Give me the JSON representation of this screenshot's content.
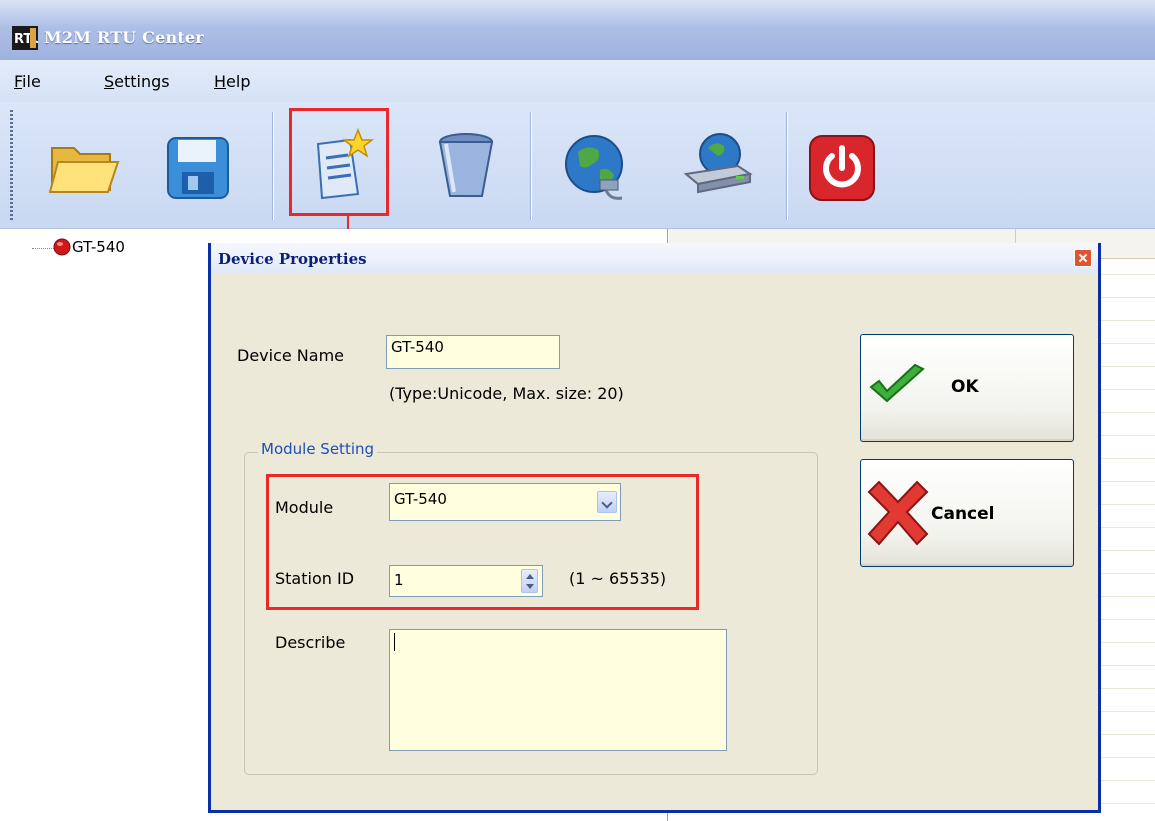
{
  "window": {
    "title": "M2M RTU Center"
  },
  "menu": [
    {
      "label": "File",
      "mnemonic": "F",
      "rest": "ile"
    },
    {
      "label": "Settings",
      "mnemonic": "S",
      "rest": "ettings"
    },
    {
      "label": "Help",
      "mnemonic": "H",
      "rest": "elp"
    }
  ],
  "toolbar": {
    "buttons": [
      "open-folder-icon",
      "save-disk-icon",
      "new-document-icon",
      "trash-bin-icon",
      "network-globe-icon",
      "network-device-icon",
      "power-icon"
    ],
    "highlighted": "new-document-icon"
  },
  "tree": {
    "nodes": [
      {
        "label": "GT-540",
        "status_color": "#d01818"
      }
    ]
  },
  "dialog": {
    "title": "Device Properties",
    "device_name_label": "Device Name",
    "device_name_value": "GT-540",
    "device_name_hint": "(Type:Unicode, Max. size: 20)",
    "group_title": "Module Setting",
    "module_label": "Module",
    "module_value": "GT-540",
    "station_label": "Station ID",
    "station_value": "1",
    "station_range": "(1 ~ 65535)",
    "describe_label": "Describe",
    "describe_value": "",
    "ok_label": "OK",
    "cancel_label": "Cancel"
  },
  "colors": {
    "highlight": "#e8282a",
    "dialog_border": "#0b2fa8",
    "field_bg": "#fffedf"
  }
}
